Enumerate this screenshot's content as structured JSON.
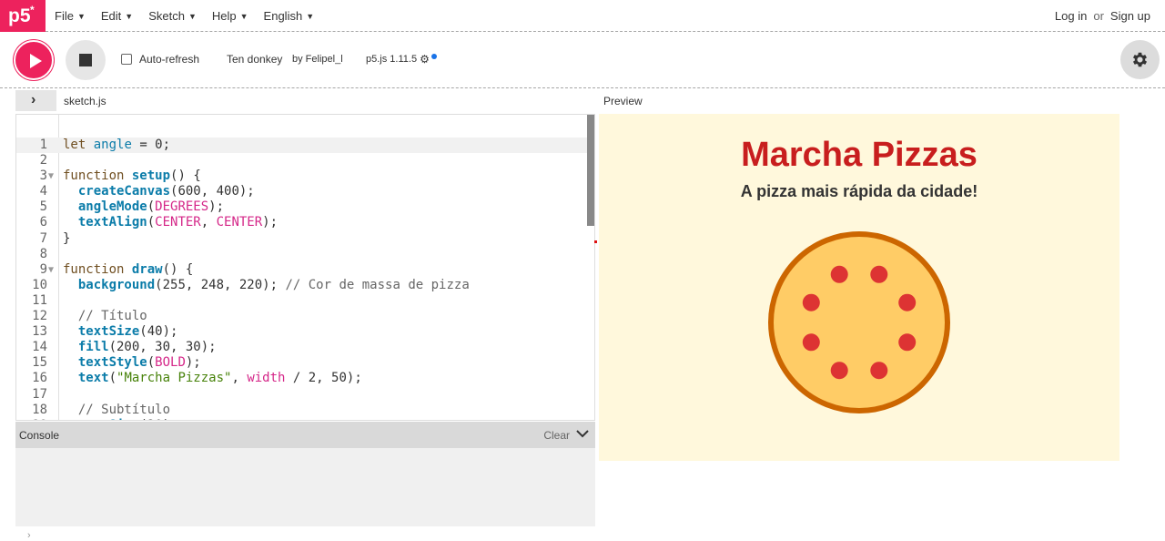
{
  "nav": {
    "menu": [
      {
        "label": "File"
      },
      {
        "label": "Edit"
      },
      {
        "label": "Sketch"
      },
      {
        "label": "Help"
      },
      {
        "label": "English"
      }
    ],
    "login": "Log in",
    "or": "or",
    "signup": "Sign up"
  },
  "toolbar": {
    "auto_refresh": "Auto-refresh",
    "project_name": "Ten donkey",
    "author": "by Felipel_l",
    "version": "p5.js 1.11.5"
  },
  "editor": {
    "file_name": "sketch.js",
    "preview_label": "Preview"
  },
  "console": {
    "title": "Console",
    "clear": "Clear"
  },
  "sketch": {
    "title": "Marcha Pizzas",
    "subtitle": "A pizza mais rápida da cidade!",
    "pepperoni_count": 8,
    "colors": {
      "background": "#fff8dc",
      "title": "#c81e1e",
      "crust": "#cc6600",
      "cheese": "#ffcc66",
      "pepperoni": "#dd3333"
    }
  },
  "colors": {
    "accent": "#ed225d",
    "console_bg": "#f0f0f0"
  }
}
